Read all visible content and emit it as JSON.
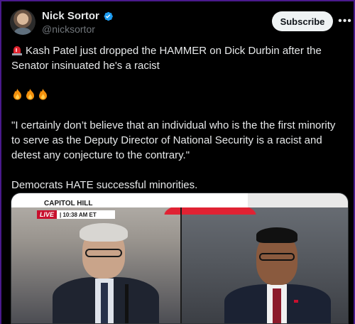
{
  "author": {
    "name": "Nick Sortor",
    "handle": "@nicksortor",
    "verified": true,
    "verified_color": "#1d9bf0"
  },
  "actions": {
    "subscribe_label": "Subscribe",
    "more_label": "•••"
  },
  "post": {
    "line1": "Kash Patel just dropped the HAMMER on Dick Durbin after the Senator insinuated he's a racist",
    "emoji_line_icons": [
      "fire-icon",
      "fire-icon",
      "fire-icon"
    ],
    "quote": "\"I certainly don’t believe that an individual who is the the first minority to serve as the Deputy Director of National Security is a racist and detest any conjecture to the contrary.\"",
    "closing": "Democrats HATE successful minorities."
  },
  "media": {
    "location": "CAPITOL HILL",
    "live_label": "LIVE",
    "time_label": "| 10:38 AM ET"
  },
  "colors": {
    "background": "#000000",
    "text": "#e7e9ea",
    "muted": "#71767b",
    "subscribe_bg": "#eff3f4",
    "news_red": "#c8102e"
  }
}
